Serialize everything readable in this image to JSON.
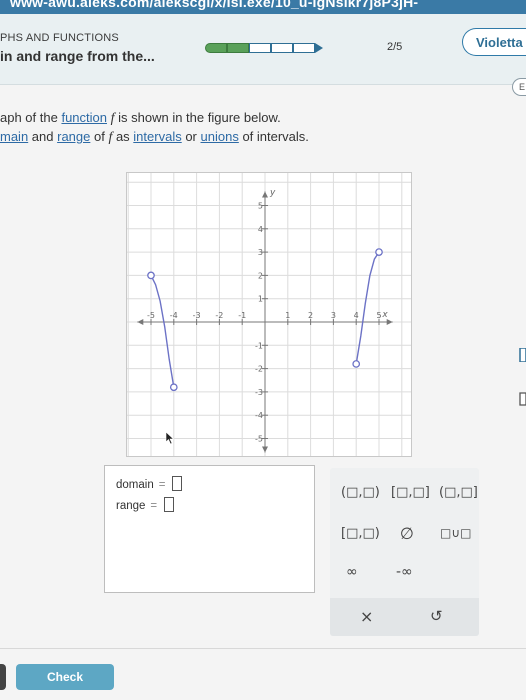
{
  "browser": {
    "url_fragment": "www-awu.aleks.com/alekscgi/x/Isl.exe/10_u-IgNslkr7j8P3jH-"
  },
  "header": {
    "topic": "PHS AND FUNCTIONS",
    "subtitle": "in and range from the...",
    "progress": {
      "completed": 2,
      "total": 5,
      "label": "2/5"
    },
    "user_name": "Violetta",
    "side_tab_label": "E"
  },
  "question": {
    "line1": {
      "prefix": "aph of the ",
      "link": "function",
      "middle": " ",
      "var": "f",
      "suffix": " is shown in the figure below."
    },
    "line2": {
      "link1": "main",
      "t1": " and ",
      "link2": "range",
      "t2": " of ",
      "var": "f",
      "t3": " as ",
      "link3": "intervals",
      "t4": " or ",
      "link4": "unions",
      "t5": " of intervals."
    }
  },
  "chart_data": {
    "type": "line",
    "xlabel": "x",
    "ylabel": "y",
    "xlim": [
      -6,
      6
    ],
    "ylim": [
      -5,
      5
    ],
    "grid": true,
    "x_ticks": [
      "-5",
      "-4",
      "-3",
      "-2",
      "-1",
      "1",
      "2",
      "3",
      "4",
      "5"
    ],
    "y_ticks": [
      "5",
      "4",
      "3",
      "2",
      "1",
      "-1",
      "-2",
      "-3",
      "-4",
      "-5"
    ],
    "series": [
      {
        "values": [
          [
            -5,
            2
          ],
          [
            -4.8,
            1.6
          ],
          [
            -4.6,
            0.9
          ],
          [
            -4.4,
            -0.2
          ],
          [
            -4.2,
            -1.6
          ],
          [
            -4,
            -2.8
          ]
        ],
        "endpoints": [
          {
            "x": -5,
            "y": 2,
            "closed": false
          },
          {
            "x": -4,
            "y": -2.8,
            "closed": false
          }
        ]
      },
      {
        "values": [
          [
            4,
            -1.8
          ],
          [
            4.2,
            -0.6
          ],
          [
            4.4,
            0.8
          ],
          [
            4.6,
            2.0
          ],
          [
            4.8,
            2.7
          ],
          [
            5,
            3
          ]
        ],
        "endpoints": [
          {
            "x": 4,
            "y": -1.8,
            "closed": false
          },
          {
            "x": 5,
            "y": 3,
            "closed": false
          }
        ]
      }
    ]
  },
  "answer": {
    "domain_label": "domain",
    "range_label": "range",
    "equals": "="
  },
  "keypad": {
    "keys": {
      "open_open": "(□,□)",
      "closed_closed": "[□,□]",
      "open_closed": "(□,□]",
      "closed_open": "[□,□)",
      "empty_set": "∅",
      "union": "□∪□",
      "infinity": "∞",
      "neg_infinity": "-∞",
      "clear": "×",
      "undo": "↺"
    }
  },
  "footer": {
    "check_label": "Check"
  },
  "colors": {
    "curve": "#6c72c6",
    "accent": "#2f6f95",
    "progress_done": "#5aa15a"
  }
}
